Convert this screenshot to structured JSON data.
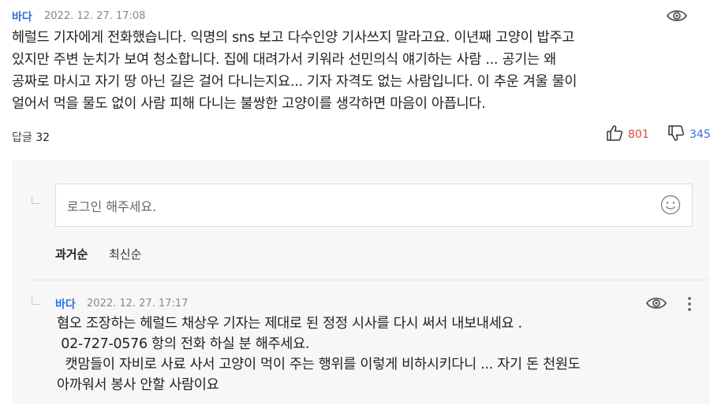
{
  "comment": {
    "author": "바다",
    "date": "2022. 12. 27. 17:08",
    "lines": [
      "헤럴드 기자에게 전화했습니다. 익명의 sns 보고 다수인양 기사쓰지 말라고요. 이년째 고양이 밥주고",
      "있지만 주변 눈치가 보여 청소합니다. 집에 대려가서 키워라 선민의식 얘기하는 사람 ... 공기는 왜",
      "공짜로 마시고 자기 땅 아닌 길은 걸어 다니는지요... 기자 자격도 없는 사람입니다.  이 추운 겨울 물이",
      "얼어서 먹을 물도 없이 사람 피해 다니는 불쌍한 고양이를 생각하면 마음이 아픕니다."
    ],
    "reply_label": "답글",
    "reply_count": "32",
    "likes": "801",
    "dislikes": "345",
    "colors": {
      "author": "#2e6fe0",
      "likes": "#e0493a",
      "dislikes": "#2e6fe0"
    }
  },
  "reply_input": {
    "placeholder": "로그인 해주세요."
  },
  "sort": {
    "oldest": "과거순",
    "newest": "최신순"
  },
  "reply": {
    "author": "바다",
    "date": "2022. 12. 27. 17:17",
    "lines": [
      "혐오 조장하는 헤럴드 채상우 기자는 제대로 된 정정 시사를 다시 써서 내보내세요 .",
      " 02-727-0576 항의 전화 하실 분 해주세요.",
      "  캣맘들이 자비로 사료 사서 고양이 먹이 주는 행위를 이렇게 비하시키다니 ... 자기 돈 천원도",
      "아까워서 봉사 안할 사람이요"
    ]
  }
}
